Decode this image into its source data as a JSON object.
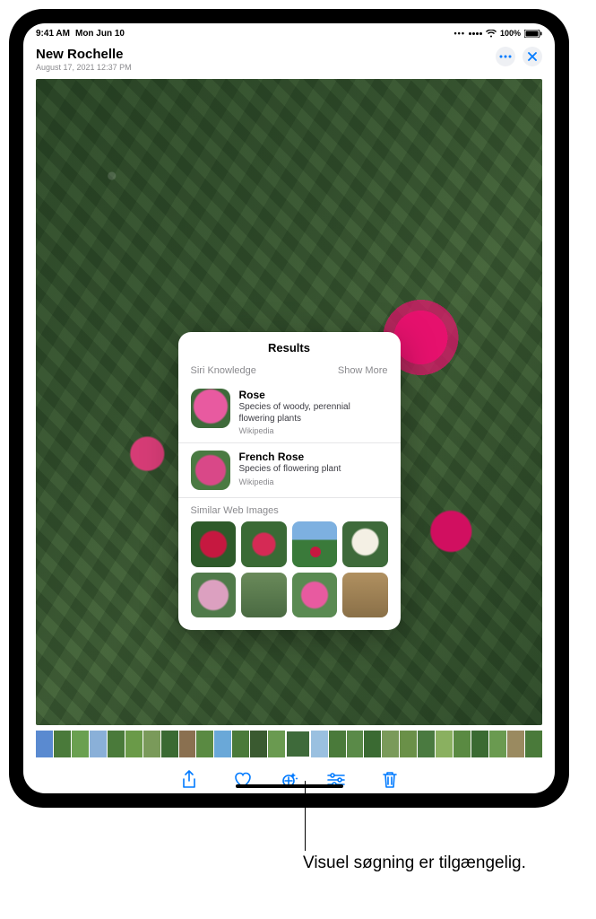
{
  "status": {
    "time": "9:41 AM",
    "date": "Mon Jun 10",
    "battery": "100%"
  },
  "header": {
    "title": "New Rochelle",
    "subtitle": "August 17, 2021  12:37 PM"
  },
  "results_card": {
    "title": "Results",
    "section_label": "Siri Knowledge",
    "show_more": "Show More",
    "similar_label": "Similar Web Images",
    "items": [
      {
        "name": "Rose",
        "desc": "Species of woody, perennial flowering plants",
        "source": "Wikipedia"
      },
      {
        "name": "French Rose",
        "desc": "Species of flowering plant",
        "source": "Wikipedia"
      }
    ]
  },
  "callout": "Visuel søgning er tilgængelig."
}
